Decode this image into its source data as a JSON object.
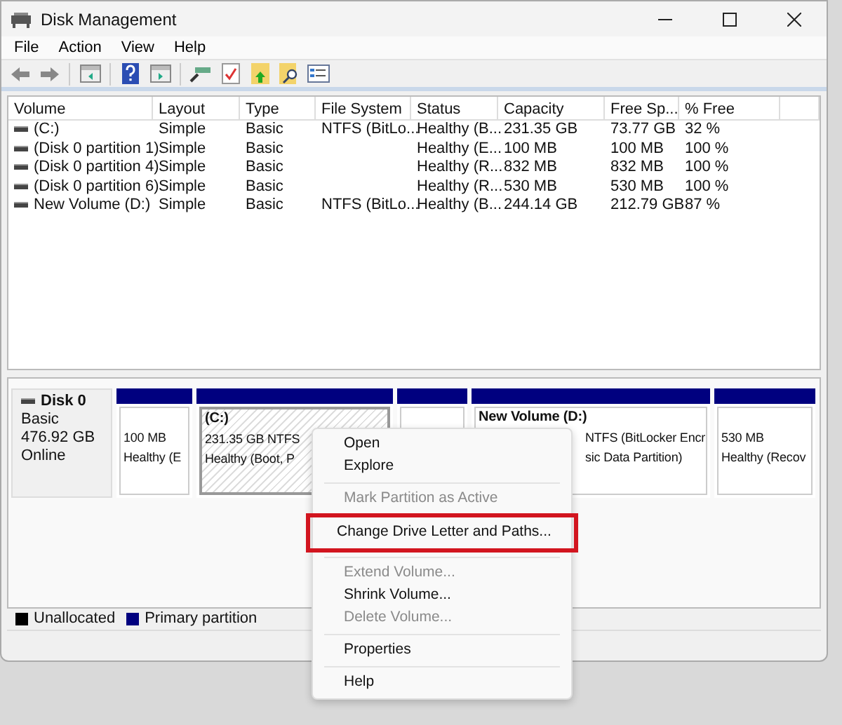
{
  "window": {
    "title": "Disk Management"
  },
  "menu": [
    "File",
    "Action",
    "View",
    "Help"
  ],
  "volume_table": {
    "columns": [
      "Volume",
      "Layout",
      "Type",
      "File System",
      "Status",
      "Capacity",
      "Free Sp...",
      "% Free"
    ],
    "rows": [
      [
        "(C:)",
        "Simple",
        "Basic",
        "NTFS (BitLo...",
        "Healthy (B...",
        "231.35 GB",
        "73.77 GB",
        "32 %"
      ],
      [
        "(Disk 0 partition 1)",
        "Simple",
        "Basic",
        "",
        "Healthy (E...",
        "100 MB",
        "100 MB",
        "100 %"
      ],
      [
        "(Disk 0 partition 4)",
        "Simple",
        "Basic",
        "",
        "Healthy (R...",
        "832 MB",
        "832 MB",
        "100 %"
      ],
      [
        "(Disk 0 partition 6)",
        "Simple",
        "Basic",
        "",
        "Healthy (R...",
        "530 MB",
        "530 MB",
        "100 %"
      ],
      [
        "New Volume (D:)",
        "Simple",
        "Basic",
        "NTFS (BitLo...",
        "Healthy (B...",
        "244.14 GB",
        "212.79 GB",
        "87 %"
      ]
    ]
  },
  "disk": {
    "name": "Disk 0",
    "type": "Basic",
    "size": "476.92 GB",
    "state": "Online",
    "partitions": [
      {
        "selected": false,
        "lines": [
          "100 MB",
          "Healthy (E"
        ]
      },
      {
        "selected": true,
        "title": "(C:)",
        "lines": [
          "231.35 GB NTFS",
          "Healthy (Boot, P"
        ]
      },
      {
        "selected": false
      },
      {
        "selected": false,
        "title": "New Volume  (D:)",
        "lines": [
          "NTFS (BitLocker Encr",
          "sic Data Partition)"
        ]
      },
      {
        "selected": false,
        "lines": [
          "530 MB",
          "Healthy (Recov"
        ]
      }
    ]
  },
  "legend": [
    {
      "label": "Unallocated",
      "color": "#000000"
    },
    {
      "label": "Primary partition",
      "color": "#00007f"
    }
  ],
  "context_menu": {
    "groups": [
      [
        {
          "label": "Open",
          "disabled": false,
          "highlighted": false
        },
        {
          "label": "Explore",
          "disabled": false,
          "highlighted": false
        }
      ],
      [
        {
          "label": "Mark Partition as Active",
          "disabled": true,
          "highlighted": false
        },
        {
          "label": "Change Drive Letter and Paths...",
          "disabled": false,
          "highlighted": true
        }
      ],
      [
        {
          "label": "Extend Volume...",
          "disabled": true,
          "highlighted": false
        },
        {
          "label": "Shrink Volume...",
          "disabled": false,
          "highlighted": false
        },
        {
          "label": "Delete Volume...",
          "disabled": true,
          "highlighted": false
        }
      ],
      [
        {
          "label": "Properties",
          "disabled": false,
          "highlighted": false
        }
      ],
      [
        {
          "label": "Help",
          "disabled": false,
          "highlighted": false
        }
      ]
    ]
  }
}
